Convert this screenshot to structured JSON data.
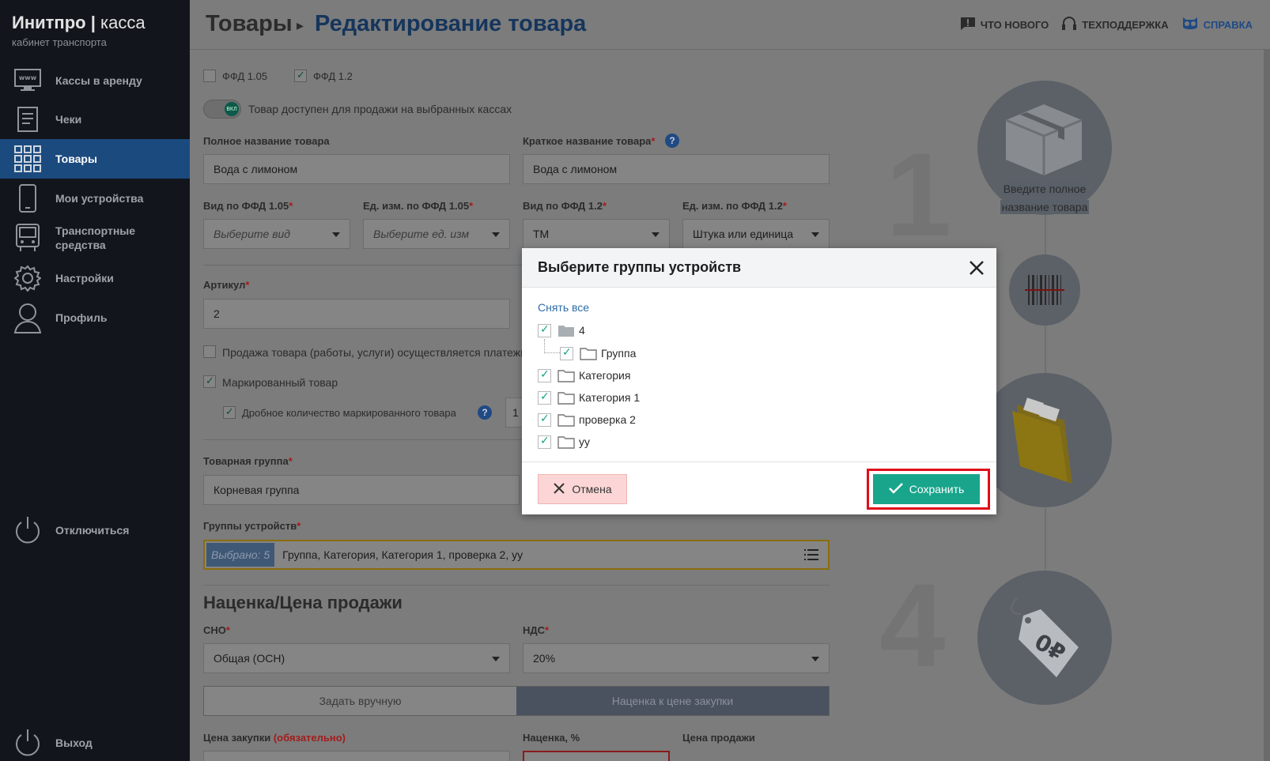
{
  "brand": {
    "title_bold": "Инитпро",
    "title_light": "касса",
    "subtitle": "кабинет транспорта"
  },
  "sidebar": {
    "items": [
      {
        "label": "Кассы в аренду",
        "icon": "monitor-www-icon"
      },
      {
        "label": "Чеки",
        "icon": "receipt-icon"
      },
      {
        "label": "Товары",
        "icon": "grid-icon",
        "active": true
      },
      {
        "label": "Мои устройства",
        "icon": "phone-icon"
      },
      {
        "label": "Транспортные средства",
        "icon": "bus-icon"
      },
      {
        "label": "Настройки",
        "icon": "gear-icon"
      },
      {
        "label": "Профиль",
        "icon": "user-icon"
      }
    ],
    "disconnect": "Отключиться",
    "logout": "Выход"
  },
  "header": {
    "crumb_parent": "Товары",
    "crumb_current": "Редактирование товара",
    "links": {
      "whats_new": "ЧТО НОВОГО",
      "support": "ТЕХПОДДЕРЖКА",
      "help": "СПРАВКА"
    }
  },
  "form": {
    "ffd105": "ФФД 1.05",
    "ffd12": "ФФД 1.2",
    "available_toggle": "Товар доступен для продажи на выбранных кассах",
    "toggle_state": "ВКЛ",
    "full_name_label": "Полное название товара",
    "full_name_value": "Вода с лимоном",
    "short_name_label": "Краткое название товара",
    "short_name_value": "Вода с лимоном",
    "kind105_label": "Вид по ФФД 1.05",
    "kind105_placeholder": "Выберите вид",
    "unit105_label": "Ед. изм. по ФФД 1.05",
    "unit105_placeholder": "Выберите ед. изм",
    "kind12_label": "Вид по ФФД 1.2",
    "kind12_value": "ТМ",
    "unit12_label": "Ед. изм. по ФФД 1.2",
    "unit12_value": "Штука или единица",
    "article_label": "Артикул",
    "article_value": "2",
    "agent_sale": "Продажа товара (работы, услуги) осуществляется платежны",
    "marked": "Маркированный товар",
    "fractional": "Дробное количество маркированного товара",
    "fractional_value": "1",
    "group_label": "Товарная группа",
    "group_value": "Корневая группа",
    "devgroups_label": "Группы устройств",
    "devgroups_badge": "Выбрано: 5",
    "devgroups_value": "Группа, Категория, Категория 1, проверка 2, уу",
    "pricing_title": "Наценка/Цена продажи",
    "sno_label": "СНО",
    "sno_value": "Общая (ОСН)",
    "nds_label": "НДС",
    "nds_value": "20%",
    "seg_manual": "Задать вручную",
    "seg_markup": "Наценка к цене закупки",
    "purchase_label": "Цена закупки",
    "purchase_required": "(обязательно)",
    "markup_label": "Наценка, %",
    "sale_price_label": "Цена продажи"
  },
  "illustration": {
    "step1": "1",
    "step4": "4",
    "hint": [
      "Введите полное",
      "название товара"
    ],
    "price_tag": "0₽"
  },
  "modal": {
    "title": "Выберите группы устройств",
    "unselect_all": "Снять все",
    "tree": [
      {
        "label": "4",
        "checked": true,
        "level": 0,
        "filled": true
      },
      {
        "label": "Группа",
        "checked": true,
        "level": 1
      },
      {
        "label": "Категория",
        "checked": true,
        "level": 0
      },
      {
        "label": "Категория 1",
        "checked": true,
        "level": 0
      },
      {
        "label": "проверка 2",
        "checked": true,
        "level": 0
      },
      {
        "label": "уу",
        "checked": true,
        "level": 0
      }
    ],
    "cancel": "Отмена",
    "save": "Сохранить"
  },
  "colors": {
    "accent": "#19a58c",
    "brand_blue": "#1f4a84",
    "highlight": "#e00d1b",
    "sidebar": "#12161c"
  }
}
